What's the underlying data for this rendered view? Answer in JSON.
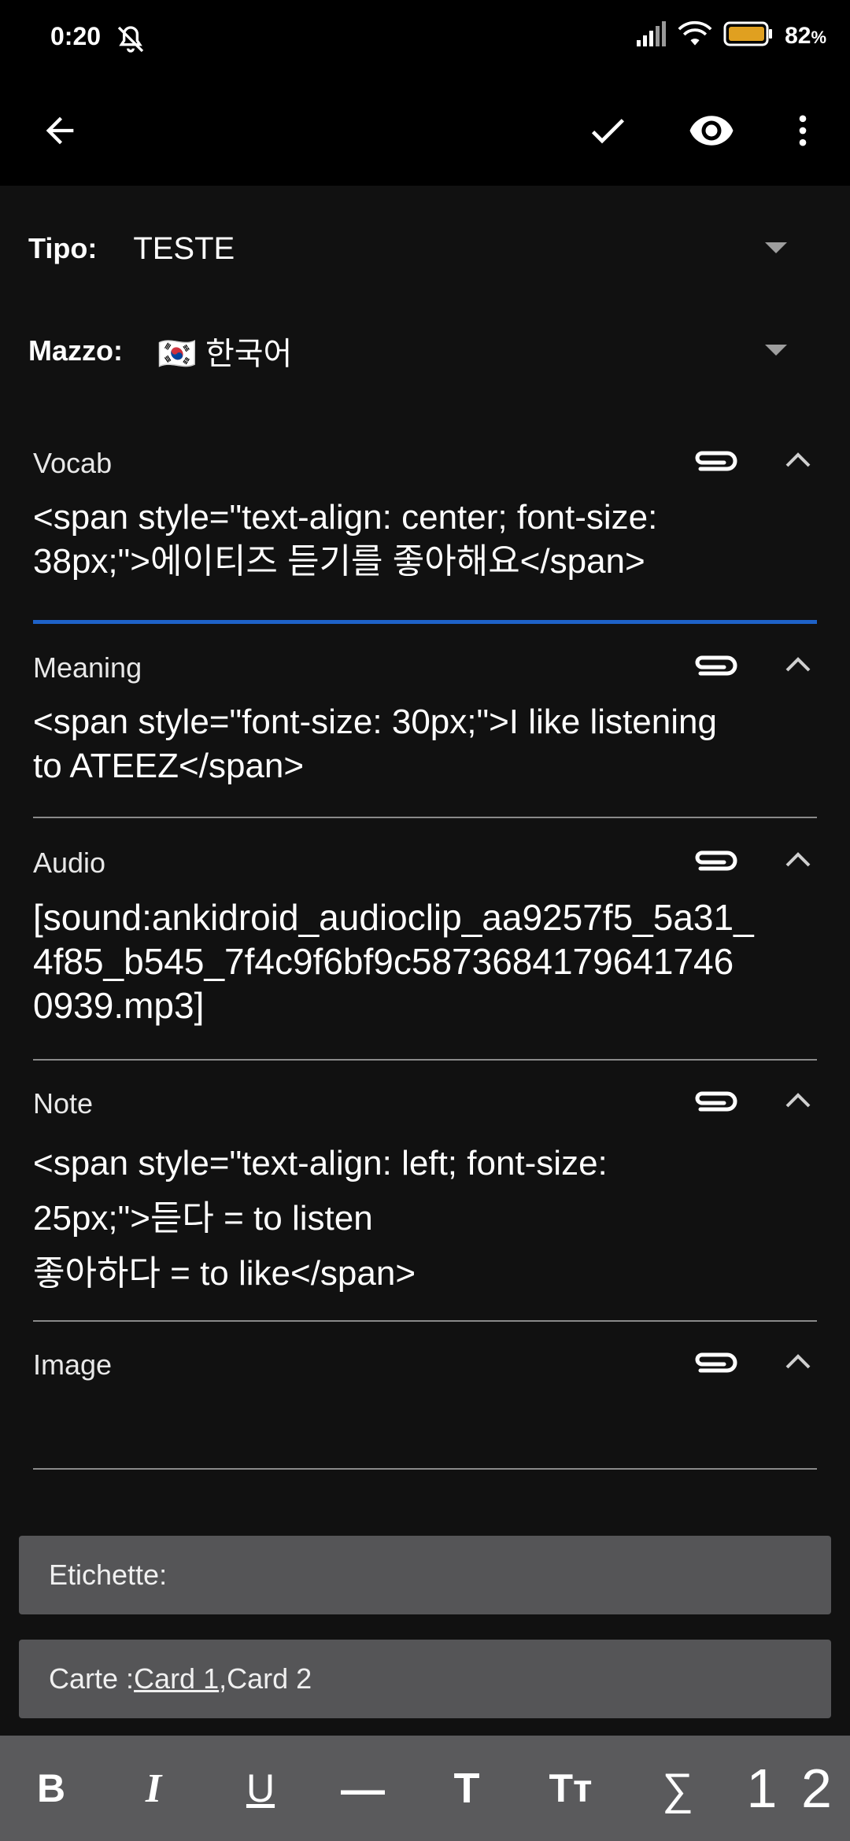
{
  "status": {
    "time": "0:20",
    "battery_pct": "82",
    "battery_unit": "%",
    "battery_color": "#e0a020"
  },
  "toolbar": {
    "back_icon": "arrow-left-icon",
    "save_icon": "check-icon",
    "preview_icon": "eye-icon",
    "menu_icon": "more-vert-icon"
  },
  "selectors": {
    "type_label": "Tipo:",
    "type_value": "TESTE",
    "deck_label": "Mazzo:",
    "deck_flag": "🇰🇷",
    "deck_value": "한국어"
  },
  "fields": [
    {
      "name": "Vocab",
      "lines": [
        "<span style=\"text-align: center; font-size:",
        "38px;\">에이티즈 듣기를 좋아해요</span>"
      ]
    },
    {
      "name": "Meaning",
      "lines": [
        "<span style=\"font-size: 30px;\">I like listening",
        "to ATEEZ</span>"
      ]
    },
    {
      "name": "Audio",
      "lines": [
        "[sound:ankidroid_audioclip_aa9257f5_5a31_",
        "4f85_b545_7f4c9f6bf9c5873684179641746",
        "0939.mp3]"
      ]
    },
    {
      "name": "Note",
      "lines": [
        "<span style=\"text-align: left; font-size:",
        "25px;\">듣다 = to listen",
        "좋아하다 = to like</span>"
      ]
    },
    {
      "name": "Image",
      "lines": []
    }
  ],
  "tags": {
    "label": "Etichette:"
  },
  "cards": {
    "prefix": "Carte : ",
    "card1": "Card 1",
    "sep": ", ",
    "card2": "Card 2"
  },
  "format_bar": {
    "bold": "B",
    "italic": "I",
    "underline": "U",
    "hr": "—",
    "title": "T",
    "font_size": "Tт",
    "mathjax": "∑",
    "custom1": "1",
    "custom2": "2"
  },
  "colors": {
    "accent": "#1e62c8",
    "background": "#111111",
    "panel": "#555557"
  }
}
